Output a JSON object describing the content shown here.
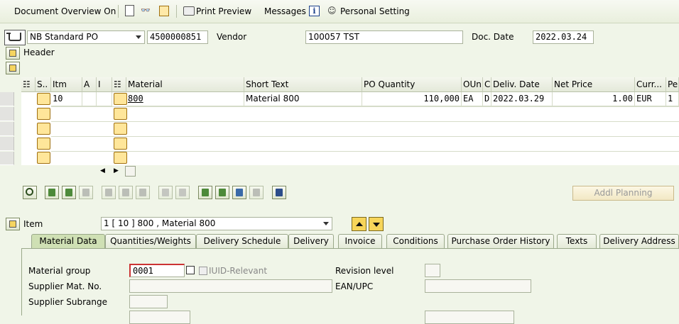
{
  "toolbar": {
    "doc_overview": "Document Overview On",
    "print_preview": "Print Preview",
    "messages": "Messages",
    "personal_setting": "Personal Setting"
  },
  "header_row": {
    "doc_type": "NB Standard PO",
    "po_number": "4500000851",
    "vendor_label": "Vendor",
    "vendor_value": "100057 TST",
    "doc_date_label": "Doc. Date",
    "doc_date_value": "2022.03.24",
    "header_label": "Header"
  },
  "grid": {
    "columns": [
      "S..",
      "Itm",
      "A",
      "I",
      "Material",
      "Short Text",
      "PO Quantity",
      "OUn",
      "C",
      "Deliv. Date",
      "Net Price",
      "Curr...",
      "Pe"
    ],
    "rows": [
      {
        "item": "10",
        "material": "800",
        "short_text": "Material 800",
        "quantity": "110,000",
        "unit": "EA",
        "cat": "D",
        "deliv_date": "2022.03.29",
        "net_price": "1.00",
        "currency": "EUR",
        "per": "1"
      }
    ]
  },
  "buttons": {
    "addl_planning": "Addl Planning"
  },
  "item_row": {
    "label": "Item",
    "selected": "1 [ 10 ] 800 , Material 800"
  },
  "tabs": [
    "Material Data",
    "Quantities/Weights",
    "Delivery Schedule",
    "Delivery",
    "Invoice",
    "Conditions",
    "Purchase Order History",
    "Texts",
    "Delivery Address"
  ],
  "material_data": {
    "material_group_label": "Material group",
    "material_group_value": "0001",
    "iuid_label": "IUID-Relevant",
    "revision_label": "Revision level",
    "supplier_mat_label": "Supplier Mat. No.",
    "ean_label": "EAN/UPC",
    "supplier_subrange_label": "Supplier Subrange"
  }
}
